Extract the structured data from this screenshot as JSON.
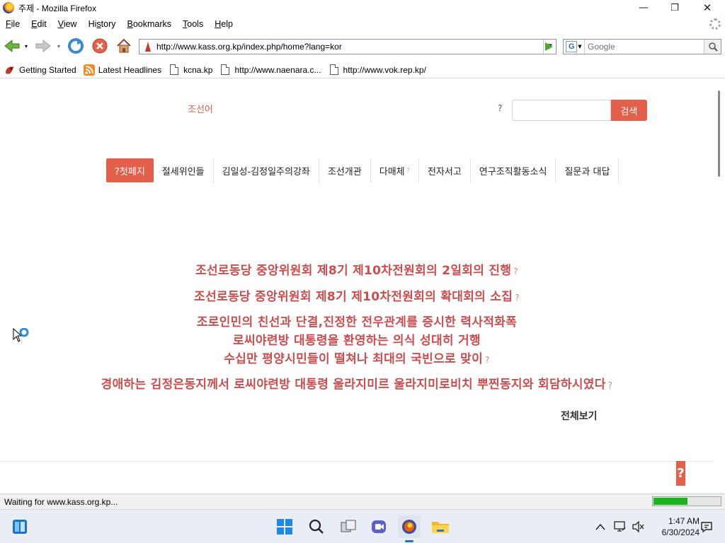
{
  "window": {
    "title": "주제 - Mozilla Firefox",
    "controls": {
      "minimize": "—",
      "restore": "❐",
      "close": "✕"
    }
  },
  "menubar": {
    "items": [
      {
        "pre": "",
        "u": "F",
        "post": "ile"
      },
      {
        "pre": "",
        "u": "E",
        "post": "dit"
      },
      {
        "pre": "",
        "u": "V",
        "post": "iew"
      },
      {
        "pre": "Hi",
        "u": "s",
        "post": "tory"
      },
      {
        "pre": "",
        "u": "B",
        "post": "ookmarks"
      },
      {
        "pre": "",
        "u": "T",
        "post": "ools"
      },
      {
        "pre": "",
        "u": "H",
        "post": "elp"
      }
    ]
  },
  "toolbar": {
    "url": "http://www.kass.org.kp/index.php/home?lang=kor",
    "search_placeholder": "Google",
    "search_engine": "G"
  },
  "bookmarks": [
    {
      "icon": "firefox-getting-started-icon",
      "label": "Getting Started"
    },
    {
      "icon": "rss-feed-icon",
      "label": "Latest Headlines"
    },
    {
      "icon": "page-icon",
      "label": "kcna.kp"
    },
    {
      "icon": "page-icon",
      "label": "http://www.naenara.c..."
    },
    {
      "icon": "page-icon",
      "label": "http://www.vok.rep.kp/"
    }
  ],
  "page": {
    "language_link": "조선어",
    "search_question": "?",
    "search_button": "검색",
    "search_value": "",
    "nav": [
      {
        "label": "?첫페지",
        "active": true
      },
      {
        "label": "절세위인들"
      },
      {
        "label": "김일성-김정일주의강좌"
      },
      {
        "label": "조선개관"
      },
      {
        "label": "다매체",
        "suffix": "?"
      },
      {
        "label": "전자서고"
      },
      {
        "label": "연구조직활동소식"
      },
      {
        "label": "질문과 대답"
      }
    ],
    "headlines": [
      {
        "text": "조선로동당 중앙위원회 제8기 제10차전원회의 2일회의 진행",
        "q": "?"
      },
      {
        "text": "조선로동당 중앙위원회 제8기 제10차전원회의 확대회의 소집",
        "q": "?"
      },
      {
        "lines": [
          "조로인민의 친선과 단결,진정한 전우관계를 증시한 력사적화폭",
          "로씨야련방 대통령을 환영하는 의식 성대히 거행",
          "수십만 평양시민들이 떨쳐나 최대의 국빈으로 맞이"
        ],
        "q": "?"
      },
      {
        "text": "경애하는 김정은동지께서 로씨야련방 대통령 울라지미르 울라지미로비치 뿌찐동지와 회담하시였다",
        "q": "?"
      }
    ],
    "view_all": "전체보기",
    "float_q": "?"
  },
  "status": {
    "text": "Waiting for www.kass.org.kp...",
    "progress": 0.5
  },
  "taskbar": {
    "time": "1:47 AM",
    "date": "6/30/2024"
  }
}
